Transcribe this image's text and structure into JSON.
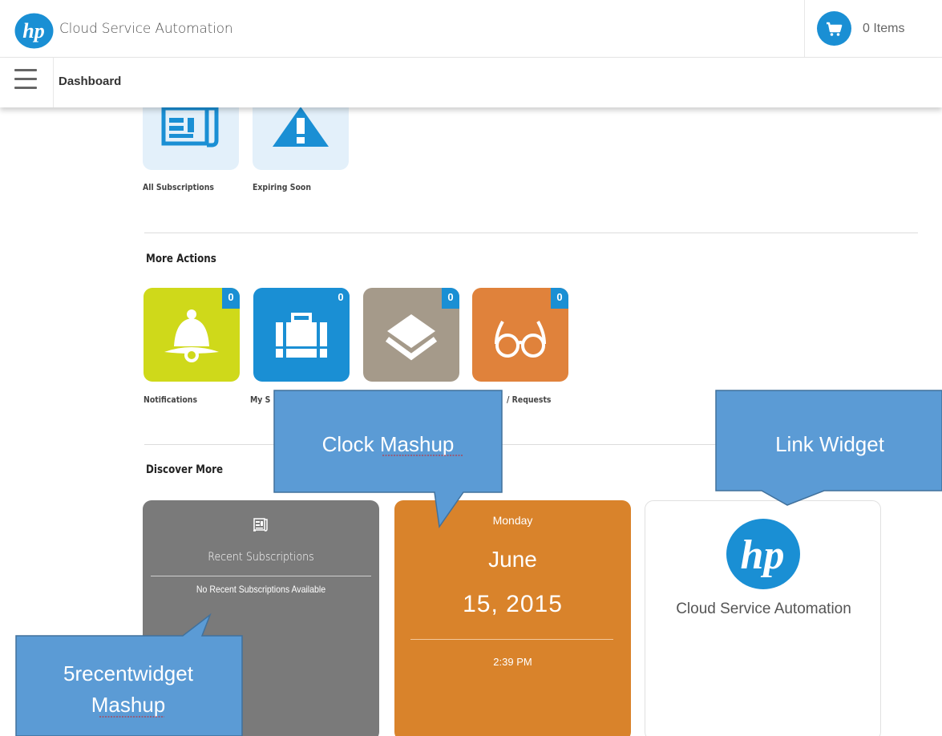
{
  "header": {
    "app_title": "Cloud Service Automation",
    "cart_label": "0 Items",
    "logo_text": "hp"
  },
  "nav": {
    "title": "Dashboard"
  },
  "subscriptions": {
    "tiles": [
      {
        "label": "All Subscriptions",
        "icon": "newspaper-icon"
      },
      {
        "label": "Expiring Soon",
        "icon": "warning-icon"
      }
    ]
  },
  "more_actions": {
    "title": "More Actions",
    "tiles": [
      {
        "label": "Notifications",
        "count": "0",
        "icon": "bell-icon",
        "color": "#cfd91a"
      },
      {
        "label": "My S",
        "count": "0",
        "icon": "briefcase-icon",
        "color": "#1a8fd4"
      },
      {
        "label": "",
        "count": "0",
        "icon": "layers-icon",
        "color": "#a59a8a"
      },
      {
        "label": "Requests",
        "label_partial": "/ Requests",
        "count": "0",
        "icon": "glasses-icon",
        "color": "#e0823b"
      }
    ]
  },
  "discover": {
    "title": "Discover More",
    "recent": {
      "title": "Recent Subscriptions",
      "empty": "No Recent Subscriptions Available"
    },
    "clock": {
      "day": "Monday",
      "month": "June",
      "date": "15, 2015",
      "time": "2:39 PM"
    },
    "link": {
      "logo_text": "hp",
      "title": "Cloud Service Automation"
    }
  },
  "callouts": {
    "clock": "Clock Mashup",
    "link": "Link Widget",
    "recent_line1": "5recentwidget",
    "recent_line2": "Mashup"
  },
  "colors": {
    "hp_blue": "#1a8fd4",
    "callout_fill": "#5b9bd5",
    "callout_border": "#41719c"
  }
}
